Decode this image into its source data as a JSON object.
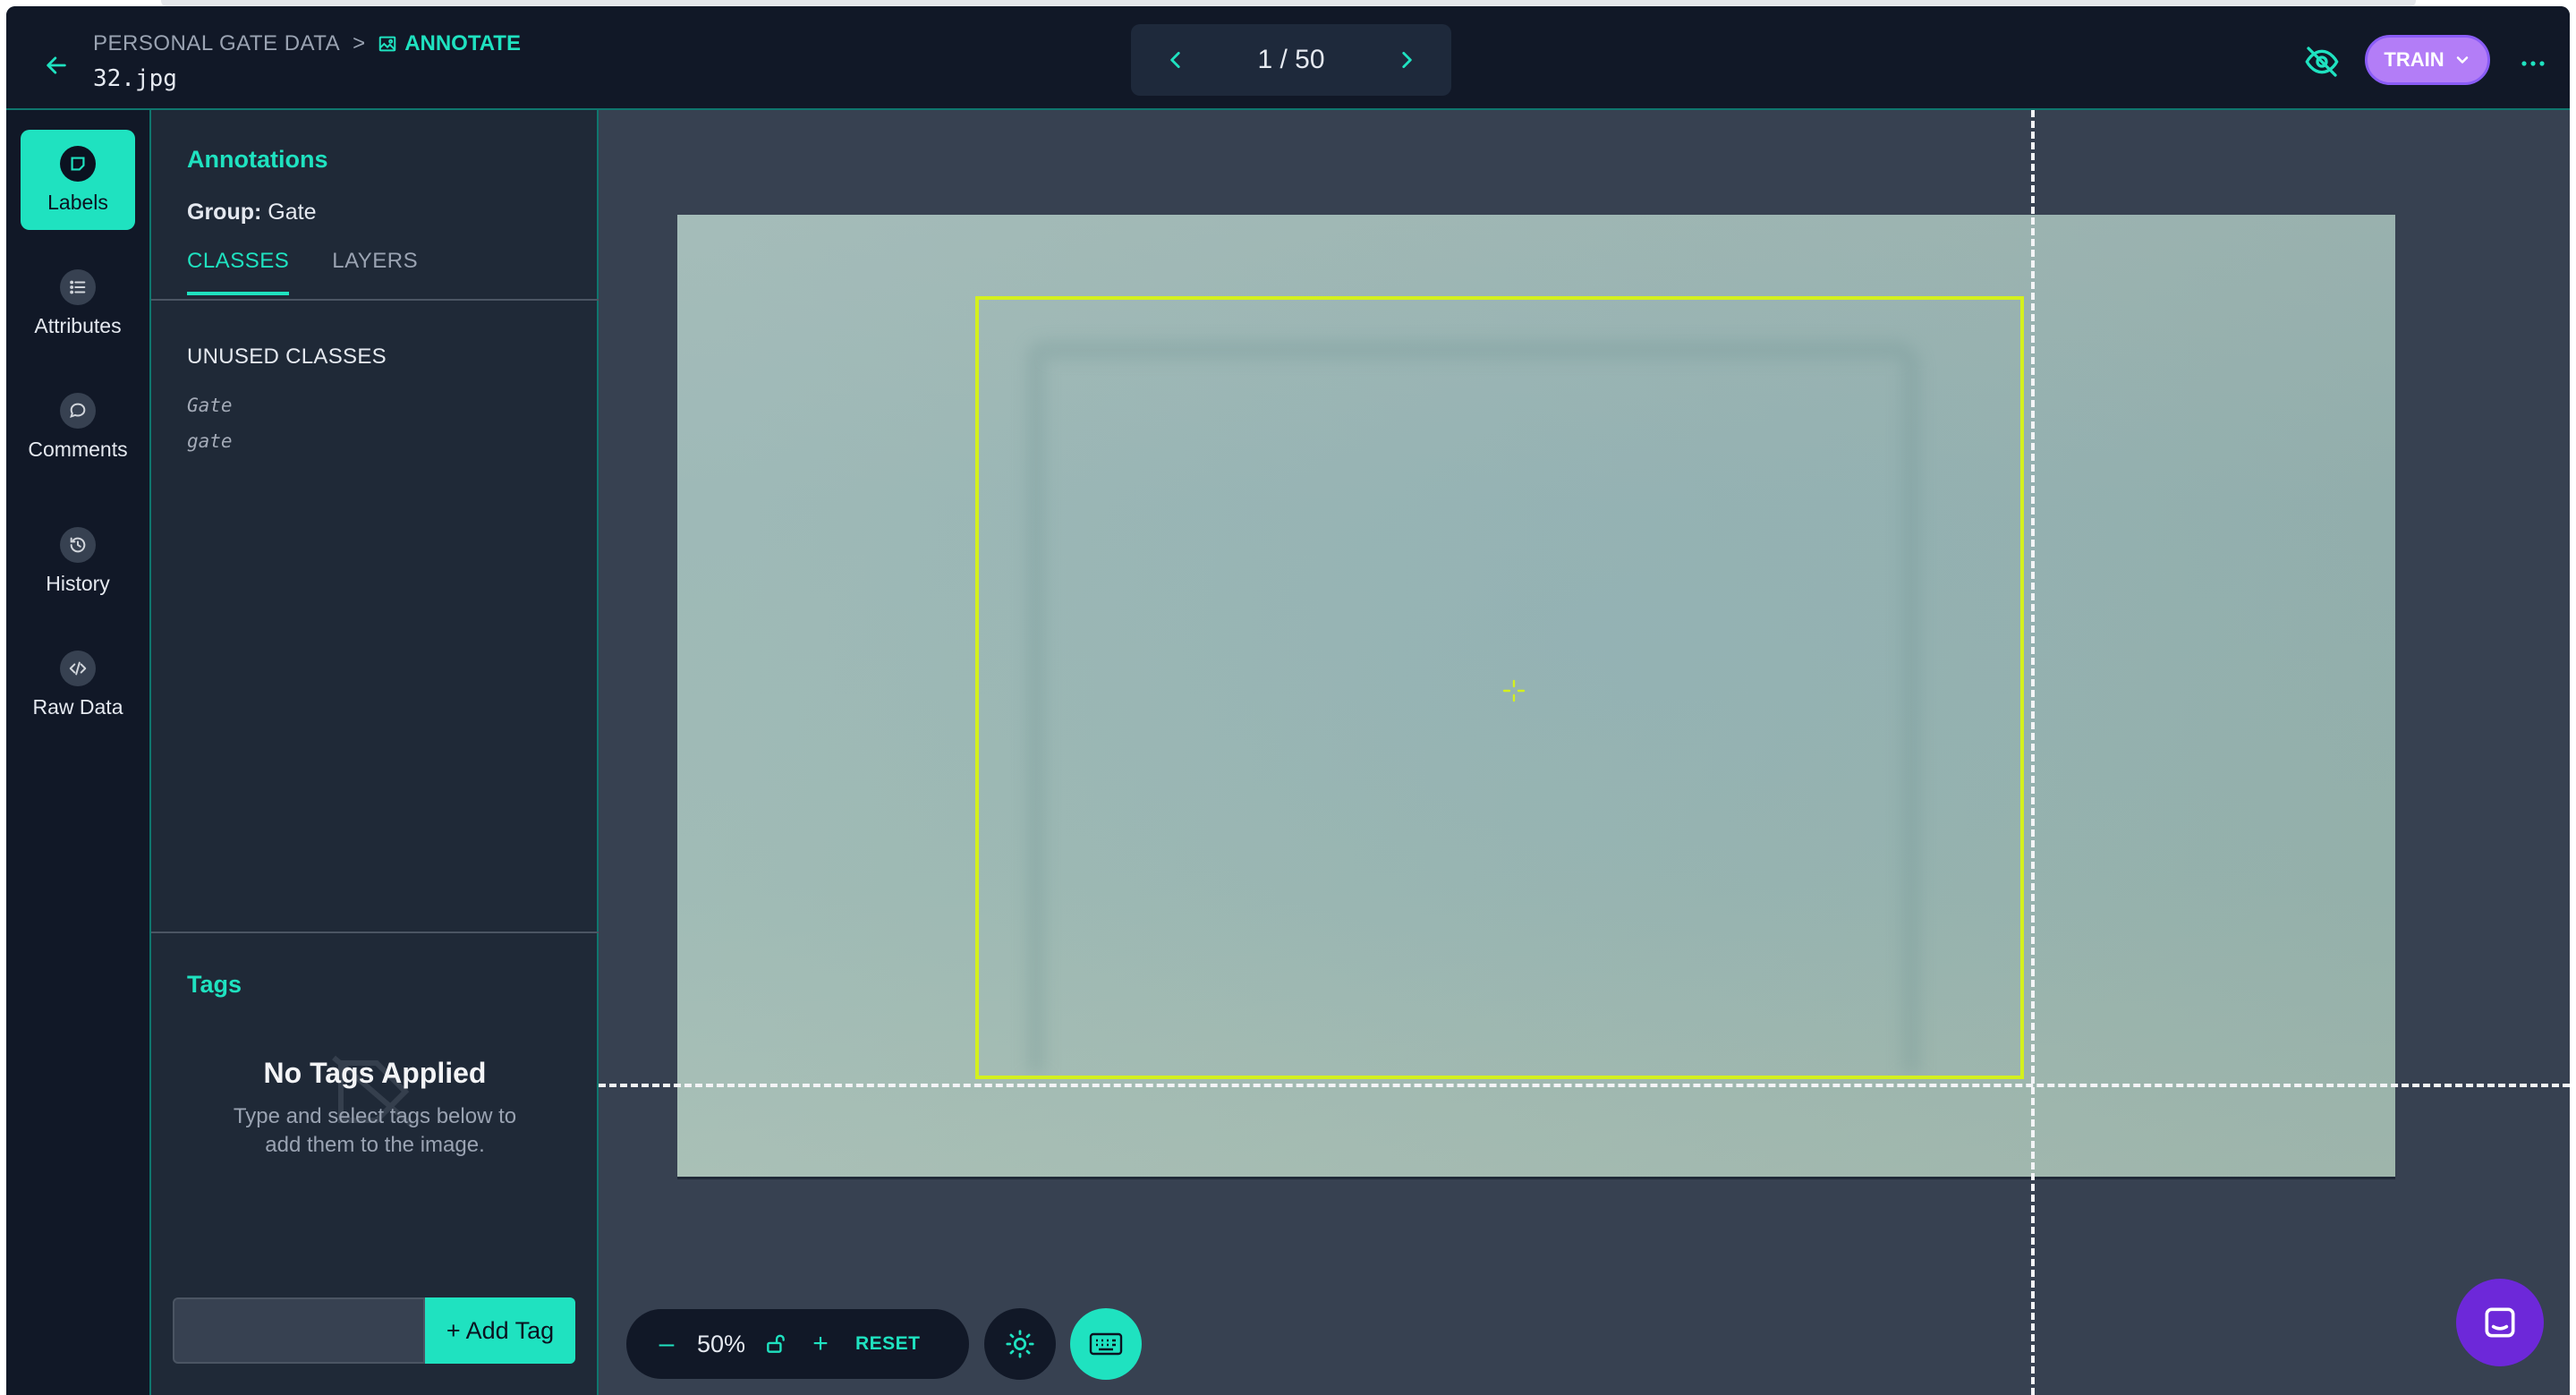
{
  "header": {
    "breadcrumb_project": "PERSONAL GATE DATA",
    "breadcrumb_separator": ">",
    "breadcrumb_current": "ANNOTATE",
    "filename": "32.jpg",
    "pager": "1 / 50",
    "train_label": "TRAIN",
    "more_label": "···"
  },
  "rail": {
    "labels": "Labels",
    "attributes": "Attributes",
    "comments": "Comments",
    "history": "History",
    "raw_data": "Raw Data"
  },
  "panel": {
    "title": "Annotations",
    "group_label": "Group:",
    "group_value": "Gate",
    "tabs": [
      "CLASSES",
      "LAYERS"
    ],
    "unused_title": "UNUSED CLASSES",
    "classes": [
      "Gate",
      "gate"
    ]
  },
  "tags": {
    "title": "Tags",
    "empty_title": "No Tags Applied",
    "empty_text_1": "Type and select tags below to",
    "empty_text_2": "add them to the image.",
    "input_value": "",
    "add_label": "+ Add Tag"
  },
  "toolbar": {
    "zoom_out": "–",
    "zoom_level": "50%",
    "zoom_in": "+",
    "reset": "RESET"
  },
  "colors": {
    "accent": "#1fe2c0",
    "train": "#b37df7",
    "annotation_box": "#d4f01e",
    "background": "#111827",
    "panel": "#1f2937",
    "canvas": "#374151",
    "chat": "#6d28d9"
  },
  "icons": {
    "back": "arrow-left-icon",
    "annotate": "image-annotate-icon",
    "prev": "chevron-left-icon",
    "next": "chevron-right-icon",
    "hide": "eye-off-icon",
    "lock": "lock-open-icon",
    "brightness": "sun-icon",
    "keyboard": "keyboard-icon",
    "chat": "chat-icon"
  }
}
